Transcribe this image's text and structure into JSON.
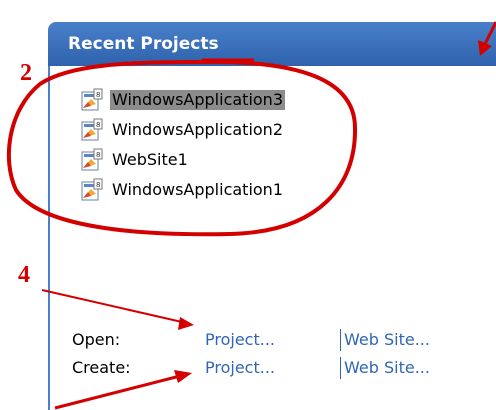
{
  "panel": {
    "title": "Recent Projects"
  },
  "projects": [
    {
      "name": "WindowsApplication3",
      "selected": true
    },
    {
      "name": "WindowsApplication2",
      "selected": false
    },
    {
      "name": "WebSite1",
      "selected": false
    },
    {
      "name": "WindowsApplication1",
      "selected": false
    }
  ],
  "actions": {
    "open_label": "Open:",
    "create_label": "Create:",
    "open_project": "Project...",
    "open_website": "Web Site...",
    "create_project": "Project...",
    "create_website": "Web Site..."
  },
  "callouts": {
    "two": "2",
    "four": "4"
  },
  "colors": {
    "header": "#2e62ad",
    "link": "#2f67b2",
    "annotation": "#d40000",
    "selection": "#8c8c8c"
  },
  "icons": {
    "project_icon": "vs-project-icon"
  }
}
